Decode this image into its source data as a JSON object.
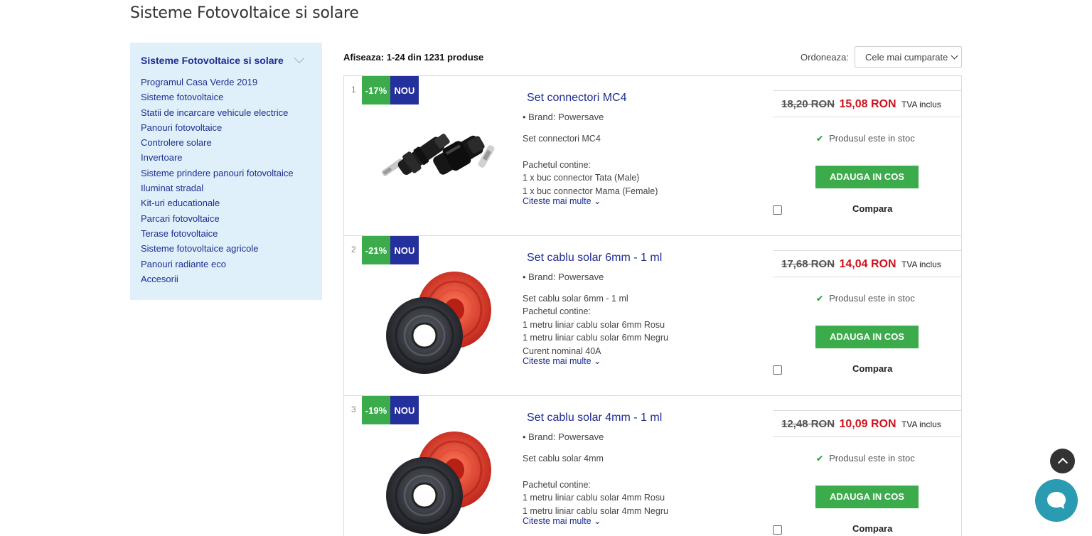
{
  "page": {
    "title": "Sisteme Fotovoltaice si solare"
  },
  "sidebar": {
    "title": "Sisteme Fotovoltaice si solare",
    "items": [
      "Programul Casa Verde 2019",
      "Sisteme fotovoltaice",
      "Statii de incarcare vehicule electrice",
      "Panouri fotovoltaice",
      "Controlere solare",
      "Invertoare",
      "Sisteme prindere panouri fotovoltaice",
      "Iluminat stradal",
      "Kit-uri educationale",
      "Parcari fotovoltaice",
      "Terase fotovoltaice",
      "Sisteme fotovoltaice agricole",
      "Panouri radiante eco",
      "Accesorii"
    ]
  },
  "toolbar": {
    "results": "Afiseaza: 1-24 din 1231 produse",
    "sort_label": "Ordoneaza:",
    "sort_value": "Cele mai cumparate"
  },
  "products": [
    {
      "index": "1",
      "discount": "-17%",
      "new": "NOU",
      "title": "Set connectori MC4",
      "brand": "• Brand: Powersave",
      "desc": [
        "Set connectori MC4",
        "",
        "Pachetul contine:",
        "1 x buc connector Tata (Male)",
        "1 x buc connector Mama (Female)"
      ],
      "more": "Citeste mai multe ⌄",
      "old_price": "18,20 RON",
      "new_price": "15,08 RON",
      "vat": "TVA inclus",
      "stock": "Produsul este in stoc",
      "add": "ADAUGA IN COS",
      "compare": "Compara",
      "image": "mc4-connector"
    },
    {
      "index": "2",
      "discount": "-21%",
      "new": "NOU",
      "title": "Set cablu solar 6mm - 1 ml",
      "brand": "• Brand: Powersave",
      "desc": [
        "Set cablu solar 6mm - 1 ml",
        "Pachetul contine:",
        "1 metru liniar cablu solar 6mm Rosu",
        "1 metru liniar cablu solar 6mm Negru",
        "Curent nominal 40A"
      ],
      "more": "Citeste mai multe ⌄",
      "old_price": "17,68 RON",
      "new_price": "14,04 RON",
      "vat": "TVA inclus",
      "stock": "Produsul este in stoc",
      "add": "ADAUGA IN COS",
      "compare": "Compara",
      "image": "cable-coils"
    },
    {
      "index": "3",
      "discount": "-19%",
      "new": "NOU",
      "title": "Set cablu solar 4mm - 1 ml",
      "brand": "• Brand: Powersave",
      "desc": [
        "Set cablu solar 4mm",
        "",
        "Pachetul contine:",
        "1 metru liniar cablu solar 4mm Rosu",
        "1 metru liniar cablu solar 4mm Negru"
      ],
      "more": "Citeste mai multe ⌄",
      "old_price": "12,48 RON",
      "new_price": "10,09 RON",
      "vat": "TVA inclus",
      "stock": "Produsul este in stoc",
      "add": "ADAUGA IN COS",
      "compare": "Compara",
      "image": "cable-coils"
    }
  ],
  "colors": {
    "accent_blue": "#1e2d8f",
    "green": "#3cab4b",
    "red": "#d0121c",
    "sidebar_bg": "#dff0fb"
  },
  "icons": {
    "scroll_top": "chevron-up-icon",
    "chat": "chat-icon"
  }
}
